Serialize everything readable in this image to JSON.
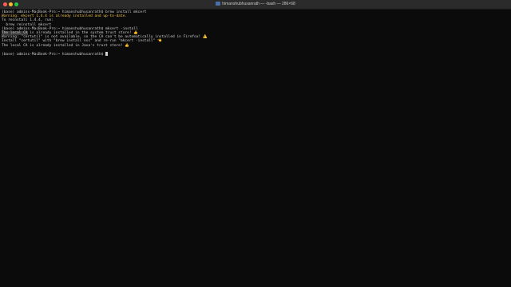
{
  "window": {
    "title": "himanshubhusanrath — -bash — 286×68"
  },
  "terminal": {
    "lines": [
      {
        "text": "(base) admins-MacBook-Pro:~ himanshubhusanrath$ brew install mkcert",
        "kind": "normal"
      },
      {
        "text": "Warning: mkcert 1.4.4 is already installed and up-to-date.",
        "kind": "warn"
      },
      {
        "text": "To reinstall 1.4.4, run:",
        "kind": "normal"
      },
      {
        "text": "  brew reinstall mkcert",
        "kind": "normal"
      },
      {
        "text": "(base) admins-MacBook-Pro:~ himanshubhusanrath$ mkcert -install",
        "kind": "normal"
      },
      {
        "sel": "The local CA",
        "text": " is already installed in the system trust store! 👍",
        "kind": "selected"
      },
      {
        "text": "Warning: \"certutil\" is not available, so the CA can't be automatically installed in Firefox! ⚠️",
        "kind": "normal"
      },
      {
        "text": "Install \"certutil\" with \"brew install nss\" and re-run \"mkcert -install\" 👈",
        "kind": "normal"
      },
      {
        "text": "The local CA is already installed in Java's trust store! 👍",
        "kind": "normal"
      },
      {
        "text": "",
        "kind": "normal"
      },
      {
        "text": "(base) admins-MacBook-Pro:~ himanshubhusanrath$ ",
        "kind": "prompt"
      }
    ]
  }
}
